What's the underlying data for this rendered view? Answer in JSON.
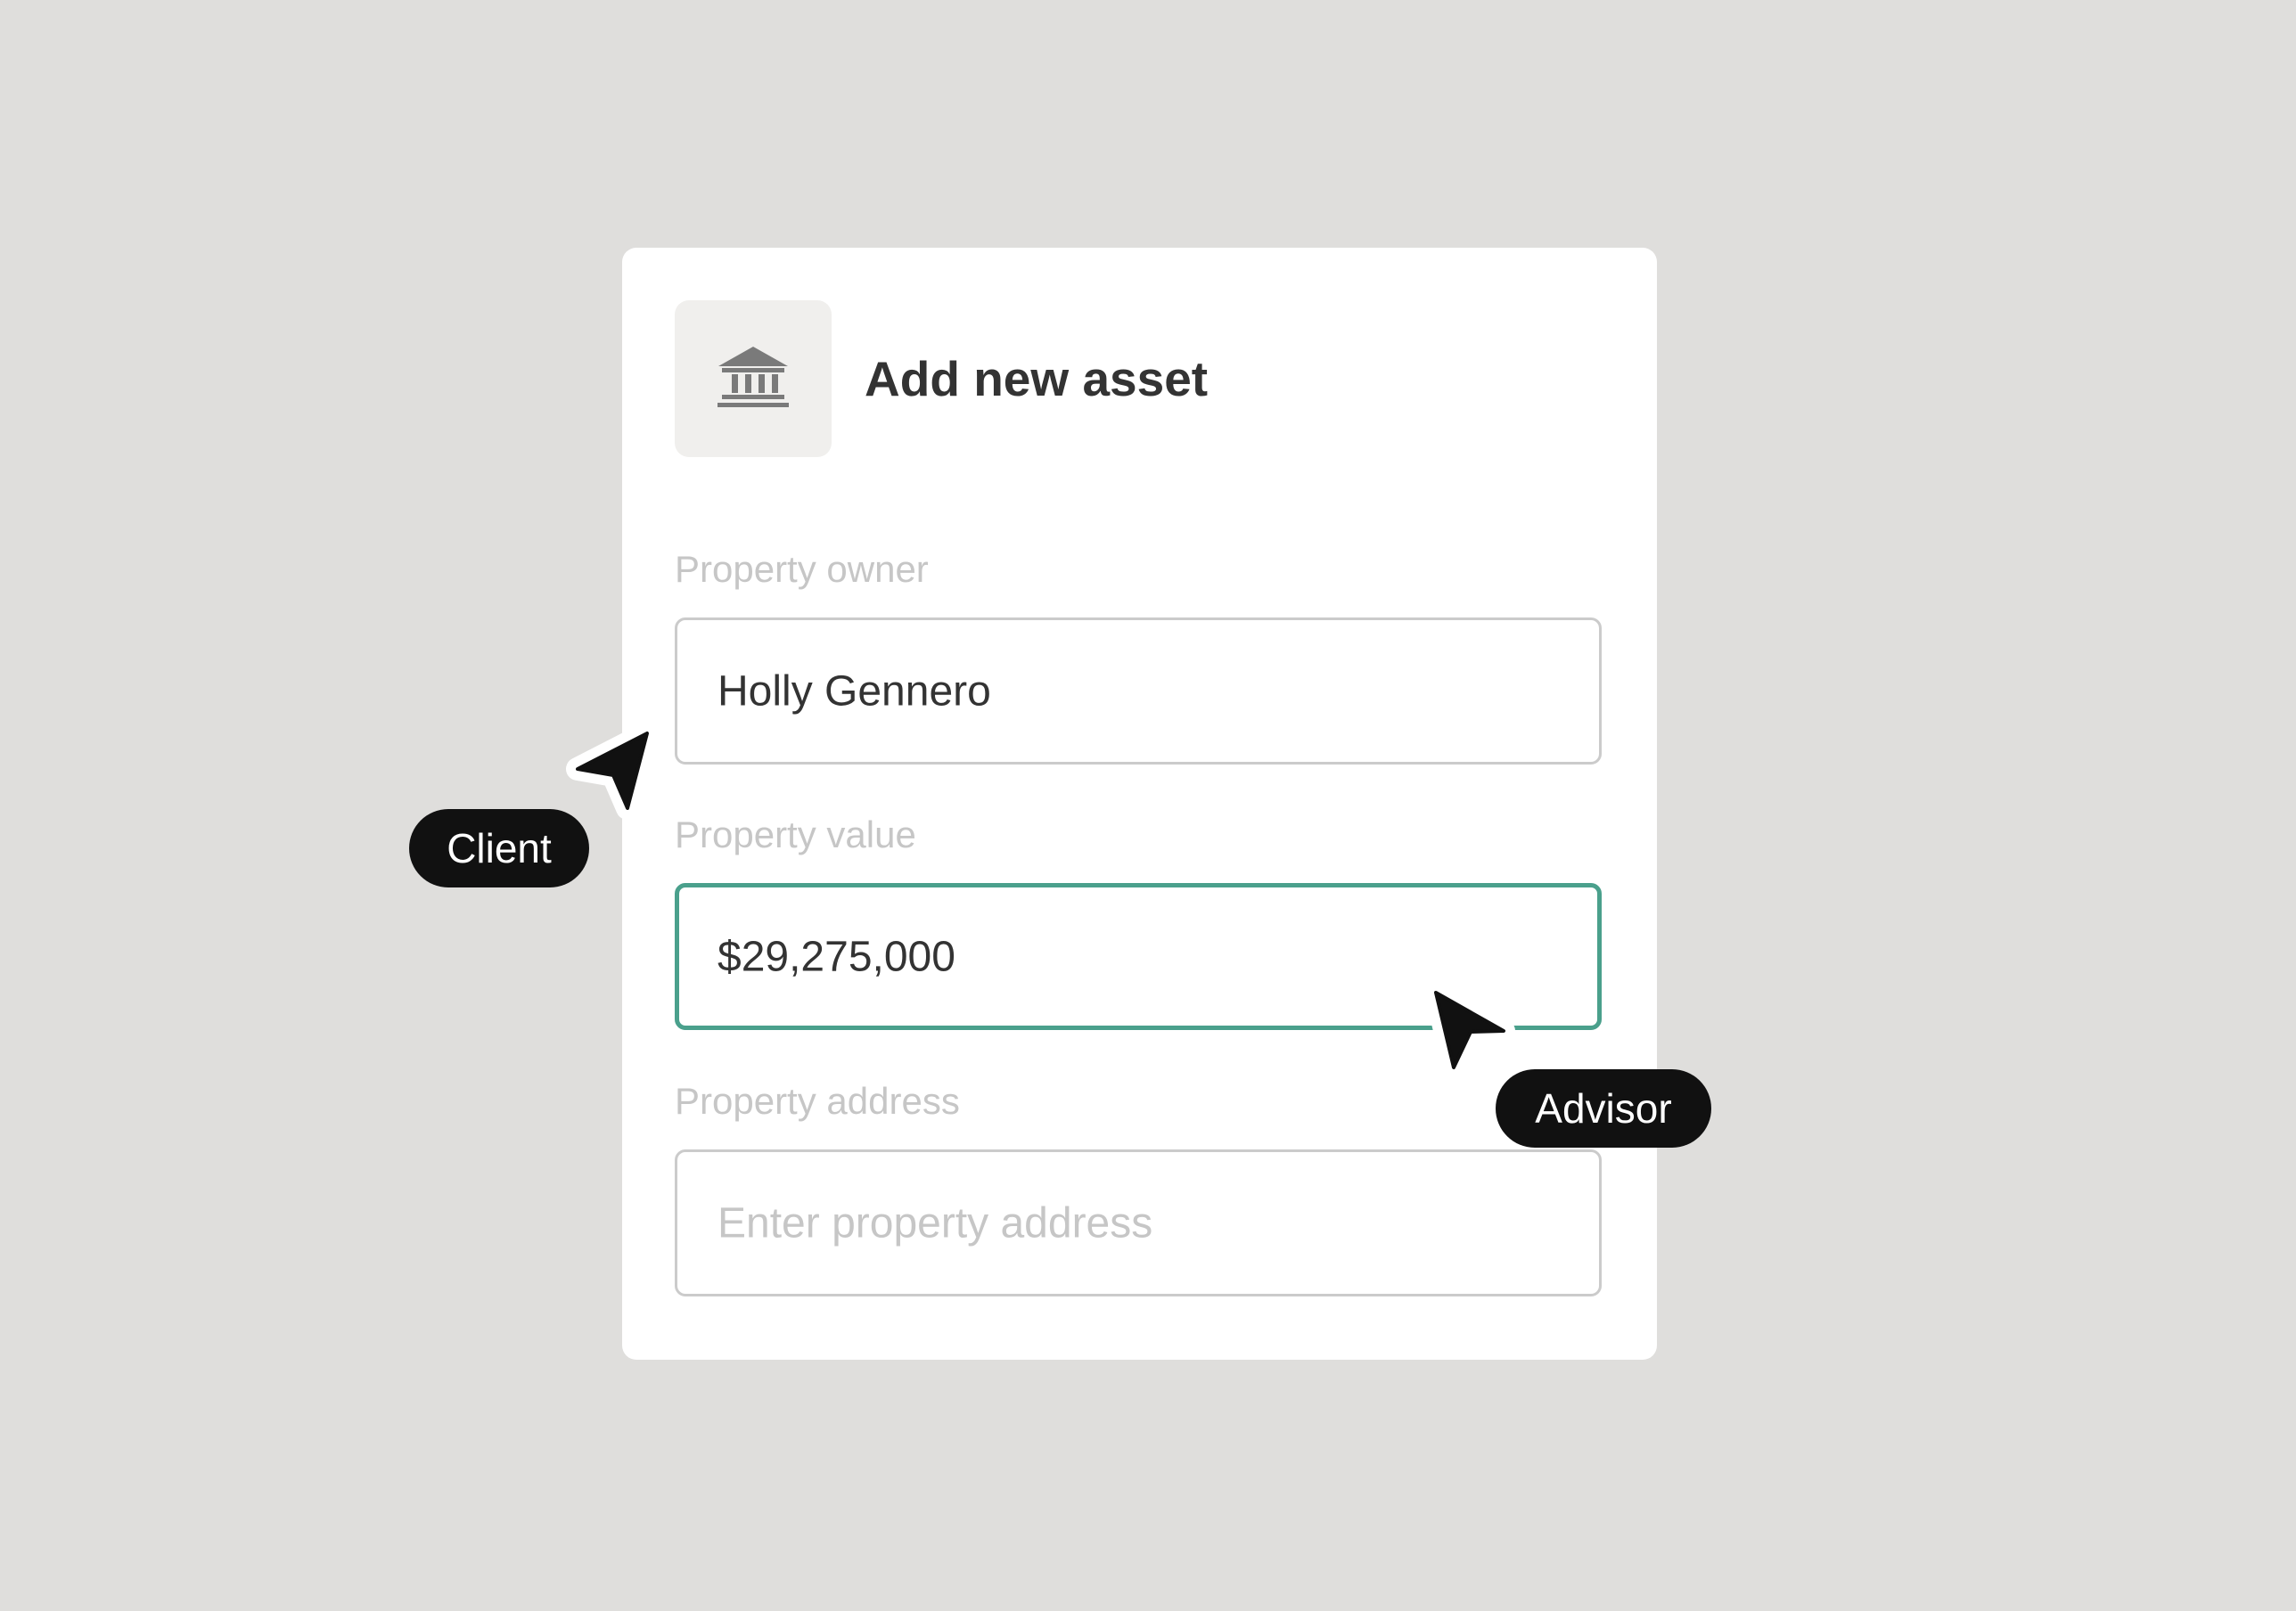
{
  "dialog": {
    "icon": "bank-icon",
    "title": "Add new asset"
  },
  "fields": {
    "owner": {
      "label": "Property owner",
      "value": "Holly Gennero"
    },
    "value": {
      "label": "Property value",
      "value": "$29,275,000",
      "focused": true
    },
    "address": {
      "label": "Property address",
      "placeholder": "Enter property address",
      "value": ""
    }
  },
  "cursors": {
    "client": {
      "label": "Client",
      "icon": "pointer-cursor-icon"
    },
    "advisor": {
      "label": "Advisor",
      "icon": "pointer-cursor-icon"
    }
  },
  "colors": {
    "background": "#dfdedc",
    "card": "#ffffff",
    "focus_border": "#4aa08c",
    "pill": "#111111"
  }
}
